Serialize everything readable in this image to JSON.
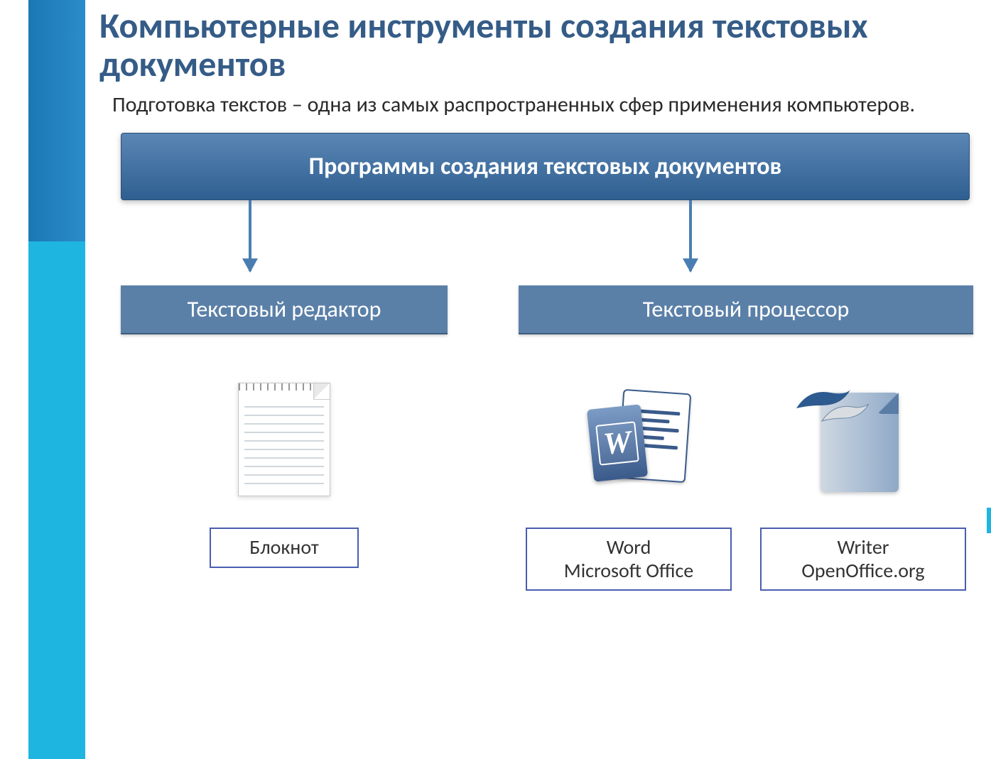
{
  "title": "Компьютерные инструменты создания текстовых документов",
  "paragraph": "Подготовка текстов – одна из самых распространенных сфер применения компьютеров.",
  "diagram": {
    "root": "Программы создания текстовых документов",
    "left": {
      "header": "Текстовый редактор",
      "apps": [
        {
          "name": "notepad",
          "label": "Блокнот"
        }
      ]
    },
    "right": {
      "header": "Текстовый процессор",
      "apps": [
        {
          "name": "word",
          "label_line1": "Word",
          "label_line2": "Microsoft Office"
        },
        {
          "name": "writer",
          "label_line1": "Writer",
          "label_line2": "OpenOffice.org"
        }
      ]
    }
  },
  "colors": {
    "title": "#355c87",
    "root_box_top": "#5a86b4",
    "root_box_bottom": "#2f5f91",
    "branch_header": "#5b80a8",
    "arrow": "#4a7eb3",
    "label_border": "#4a5db0",
    "sidebar_top": "#1b78b4",
    "sidebar_bottom": "#1fb5e1"
  }
}
